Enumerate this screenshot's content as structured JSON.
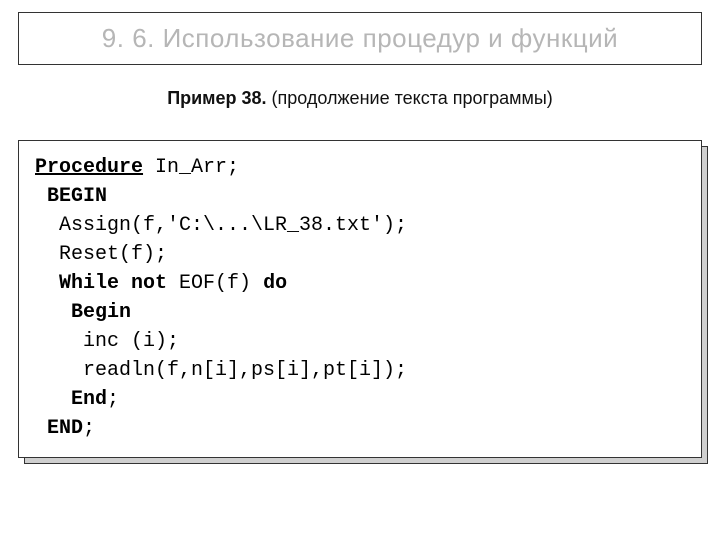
{
  "title": "9. 6. Использование процедур и функций",
  "subtitle": {
    "label": "Пример 38.",
    "rest": "  (продолжение текста программы)"
  },
  "code": {
    "l1a": "Procedure",
    "l1b": " In_Arr;",
    "l2": " BEGIN",
    "l3": "  Assign(f,'C:\\...\\LR_38.txt');",
    "l4": "  Reset(f);",
    "l5a": "  ",
    "l5b": "While not",
    "l5c": " EOF(f) ",
    "l5d": "do",
    "l6": "   Begin",
    "l7": "    inc (i);",
    "l8": "    readln(f,n[i],ps[i],pt[i]);",
    "l9": "   End",
    "l9s": ";",
    "l10": " END",
    "l10s": ";"
  }
}
